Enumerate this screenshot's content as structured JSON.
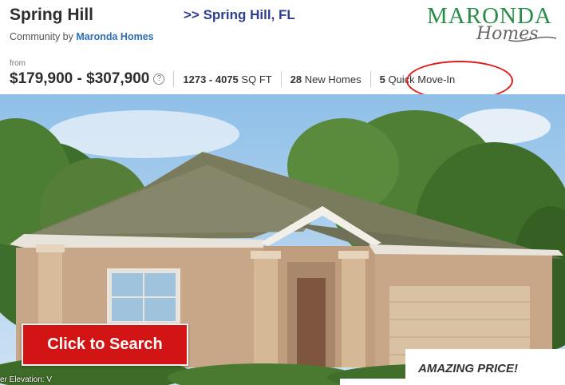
{
  "community": {
    "title": "Spring Hill",
    "subtitle_prefix": "Community by",
    "builder_link": "Maronda Homes",
    "location_heading": ">> Spring Hill, FL"
  },
  "logo": {
    "top_text": "MARONDA",
    "bottom_text": "Homes"
  },
  "stats": {
    "from_label": "from",
    "price_range": "$179,900 - $307,900",
    "info_glyph": "?",
    "sqft_range": "1273 - 4075",
    "sqft_unit": "SQ FT",
    "new_homes_count": "28",
    "new_homes_label": "New Homes",
    "quick_movein_count": "5",
    "quick_movein_label": "Quick Move-In"
  },
  "hero": {
    "cta_label": "Click to Search",
    "banner_label": "AMAZING PRICE!",
    "caption": "er Elevation: V"
  },
  "colors": {
    "annotation_circle": "#e21b1b",
    "cta_background": "#d21414",
    "brand_green": "#2b8b4a",
    "link_blue": "#2f6fb5",
    "location_navy": "#2f3f8f"
  },
  "icons": {
    "info": "info-icon"
  }
}
